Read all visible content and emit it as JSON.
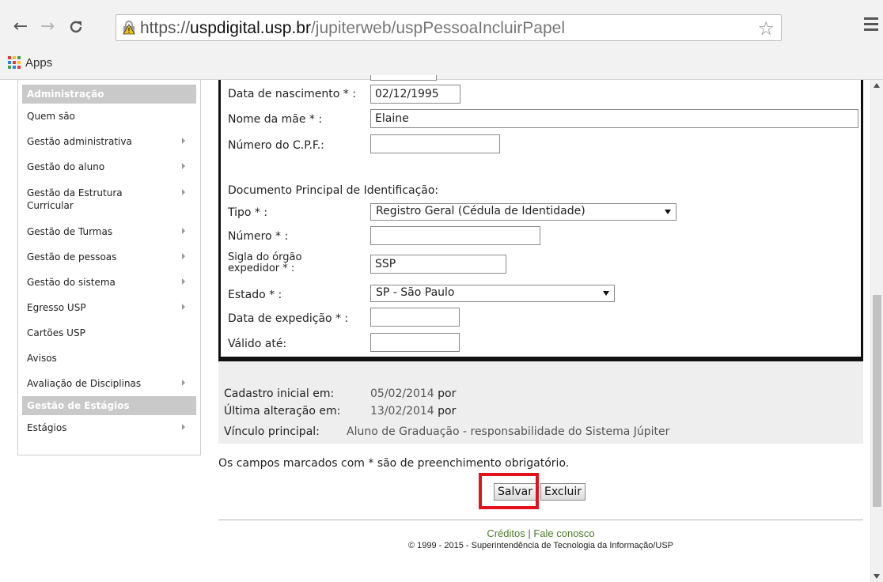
{
  "browser": {
    "url_scheme": "https://",
    "url_host": "uspdigital.usp.br",
    "url_path": "/jupiterweb/uspPessoaIncluirPapel",
    "bookmark_apps_label": "Apps"
  },
  "sidebar": {
    "header_admin": "Administração",
    "items": [
      {
        "label": "Quem são"
      },
      {
        "label": "Gestão administrativa"
      },
      {
        "label": "Gestão do aluno"
      },
      {
        "label": "Gestão da Estrutura Curricular"
      },
      {
        "label": "Gestão de Turmas"
      },
      {
        "label": "Gestão de pessoas"
      },
      {
        "label": "Gestão do sistema"
      },
      {
        "label": "Egresso USP"
      },
      {
        "label": "Cartões USP"
      },
      {
        "label": "Avisos"
      },
      {
        "label": "Avaliação de Disciplinas"
      }
    ],
    "header_estagios": "Gestão de Estágios",
    "estagios_item": "Estágios"
  },
  "form": {
    "birth_label": "Data de nascimento * :",
    "birth_value": "02/12/1995",
    "mother_label": "Nome da mãe * :",
    "mother_value": "Elaine",
    "cpf_label": "Número do C.P.F.:",
    "cpf_value": "",
    "doc_section_label": "Documento Principal de Identificação:",
    "tipo_label": "Tipo * :",
    "tipo_value": "Registro Geral (Cédula de Identidade)",
    "numero_label": "Número * :",
    "numero_value": "",
    "sigla_label_line1": "Sigla do órgão",
    "sigla_label_line2": "expedidor * :",
    "sigla_value": "SSP",
    "estado_label": "Estado * :",
    "estado_value": "SP - São Paulo",
    "expedicao_label": "Data de expedição * :",
    "expedicao_value": "",
    "valido_label": "Válido até:",
    "valido_value": ""
  },
  "info": {
    "cadastro_label": "Cadastro inicial em:",
    "cadastro_date": "05/02/2014",
    "cadastro_por": "por",
    "alteracao_label": "Última alteração em:",
    "alteracao_date": "13/02/2014",
    "alteracao_por": "por",
    "vinculo_label": "Vínculo principal:",
    "vinculo_value": "Aluno de Graduação - responsabilidade do Sistema Júpiter"
  },
  "note": "Os campos marcados com * são de preenchimento obrigatório.",
  "buttons": {
    "save": "Salvar",
    "delete": "Excluir"
  },
  "footer": {
    "creditos": "Créditos",
    "separator": " | ",
    "fale": "Fale conosco",
    "copyright": "© 1999 - 2015 - Superintendência de Tecnologia da Informação/USP"
  },
  "colors": {
    "highlight": "#e2121b",
    "sidebar_header": "#c9c9c9",
    "footer_link": "#4c7a2d"
  }
}
